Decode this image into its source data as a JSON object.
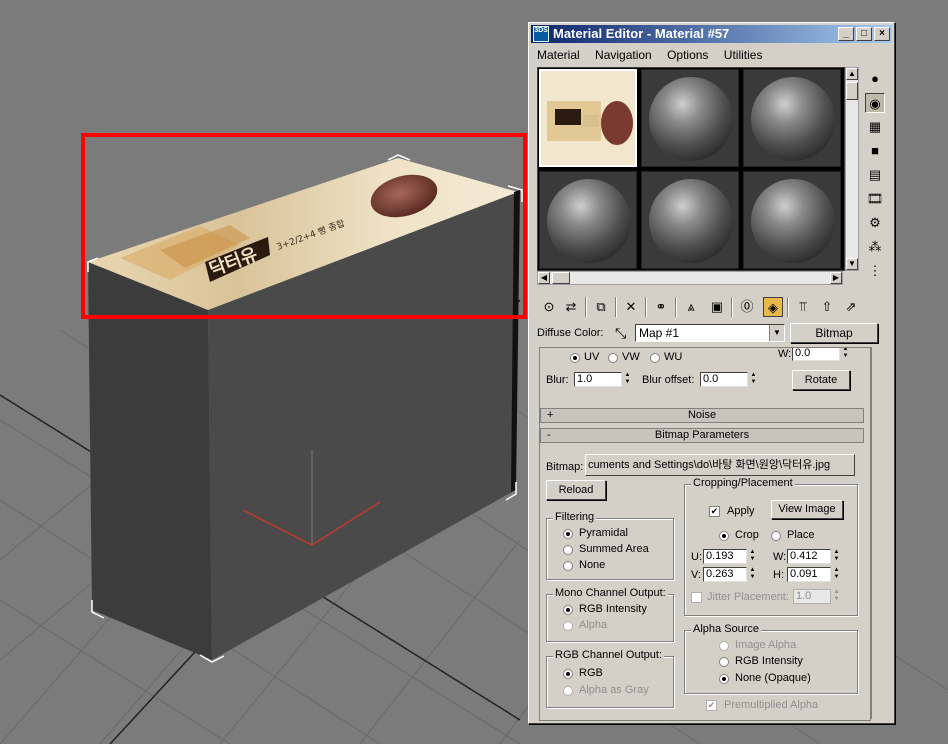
{
  "window": {
    "title": "Material Editor - Material #57",
    "app_icon": "3ds-max-icon",
    "controls": {
      "minimize": "_",
      "maximize": "□",
      "close": "×"
    }
  },
  "menu": [
    {
      "label": "Material",
      "underline": "M"
    },
    {
      "label": "Navigation",
      "underline": "N"
    },
    {
      "label": "Options",
      "underline": "O"
    },
    {
      "label": "Utilities",
      "underline": "U"
    }
  ],
  "box_texture": {
    "brand": "닥터유",
    "subtitle": "3+2/2+4 빵 종합"
  },
  "diffuse": {
    "label": "Diffuse Color:",
    "map_name": "Map #1",
    "map_type_button": "Bitmap"
  },
  "coordinates": {
    "uv": "UV",
    "vw": "VW",
    "wu": "WU",
    "w_label": "W:",
    "w_value": "0.0",
    "blur_label": "Blur:",
    "blur_value": "1.0",
    "blur_offset_label": "Blur offset:",
    "blur_offset_value": "0.0",
    "rotate_button": "Rotate"
  },
  "rollouts": {
    "noise": {
      "sign": "+",
      "label": "Noise"
    },
    "bitmap_params": {
      "sign": "-",
      "label": "Bitmap Parameters"
    }
  },
  "bitmap": {
    "label": "Bitmap:",
    "path": "cuments and Settings\\do\\바탕 화면\\원앙\\닥터유.jpg",
    "reload_button": "Reload"
  },
  "filtering": {
    "title": "Filtering",
    "options": [
      "Pyramidal",
      "Summed Area",
      "None"
    ],
    "selected": "Pyramidal"
  },
  "mono_channel": {
    "title": "Mono Channel Output:",
    "options": [
      "RGB Intensity",
      "Alpha"
    ],
    "selected": "RGB Intensity"
  },
  "rgb_channel": {
    "title": "RGB Channel Output:",
    "options": [
      "RGB",
      "Alpha as Gray"
    ],
    "selected": "RGB"
  },
  "cropping": {
    "title": "Cropping/Placement",
    "apply_label": "Apply",
    "apply_checked": true,
    "view_image_button": "View Image",
    "crop_label": "Crop",
    "place_label": "Place",
    "mode": "Crop",
    "u_label": "U:",
    "u_value": "0.193",
    "v_label": "V:",
    "v_value": "0.263",
    "w_label": "W:",
    "w_value": "0.412",
    "h_label": "H:",
    "h_value": "0.091",
    "jitter_label": "Jitter Placement:",
    "jitter_value": "1.0"
  },
  "alpha_source": {
    "title": "Alpha Source",
    "options": [
      "Image Alpha",
      "RGB Intensity",
      "None (Opaque)"
    ],
    "selected": "None (Opaque)"
  },
  "premultiplied": {
    "label": "Premultiplied Alpha",
    "checked": true
  },
  "colors": {
    "selection_rect": "#ff0000",
    "title_gradient_start": "#0a246a",
    "title_gradient_end": "#a6caf0",
    "window_face": "#d4d0c8",
    "viewport_bg": "#7b7b7b"
  }
}
